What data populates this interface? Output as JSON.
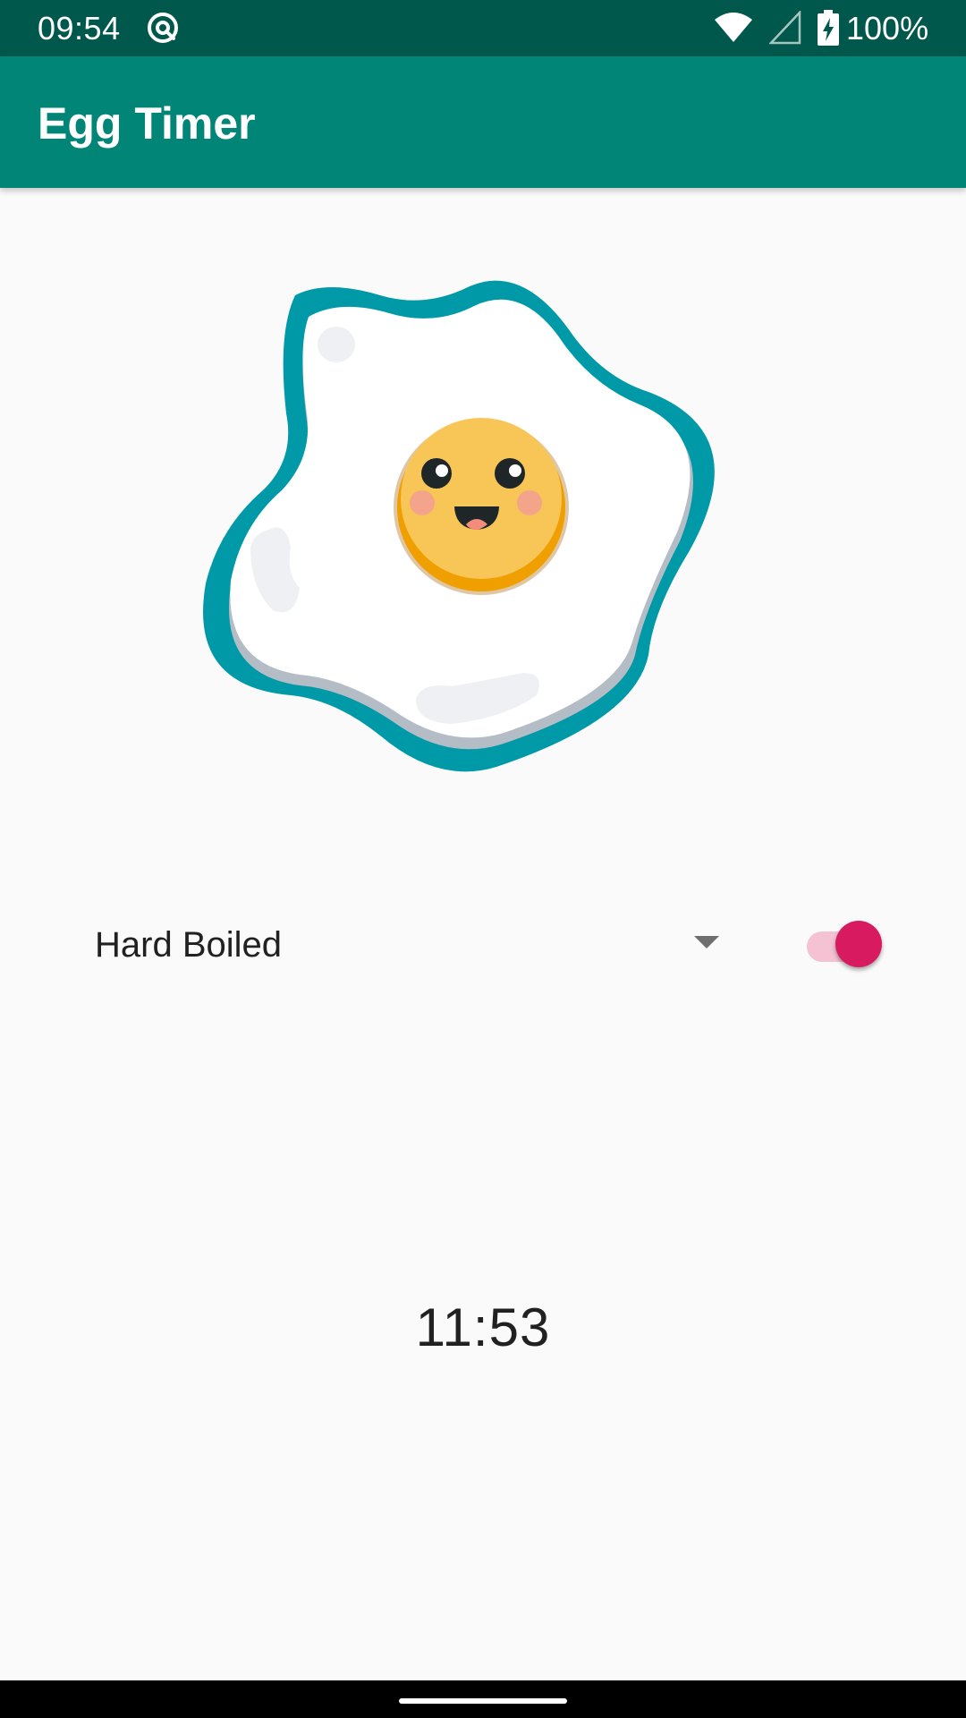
{
  "status_bar": {
    "time": "09:54",
    "battery_text": "100%",
    "icons": [
      "app-notification-icon",
      "wifi-icon",
      "cellular-signal-icon",
      "battery-charging-icon"
    ]
  },
  "app_bar": {
    "title": "Egg Timer",
    "color": "#008577",
    "status_color": "#00574b"
  },
  "illustration": {
    "name": "fried-egg-illustration"
  },
  "egg_selector": {
    "selected": "Hard Boiled"
  },
  "notification_switch": {
    "checked": true,
    "accent_color": "#d81b60"
  },
  "timer": {
    "time": "11:53"
  }
}
